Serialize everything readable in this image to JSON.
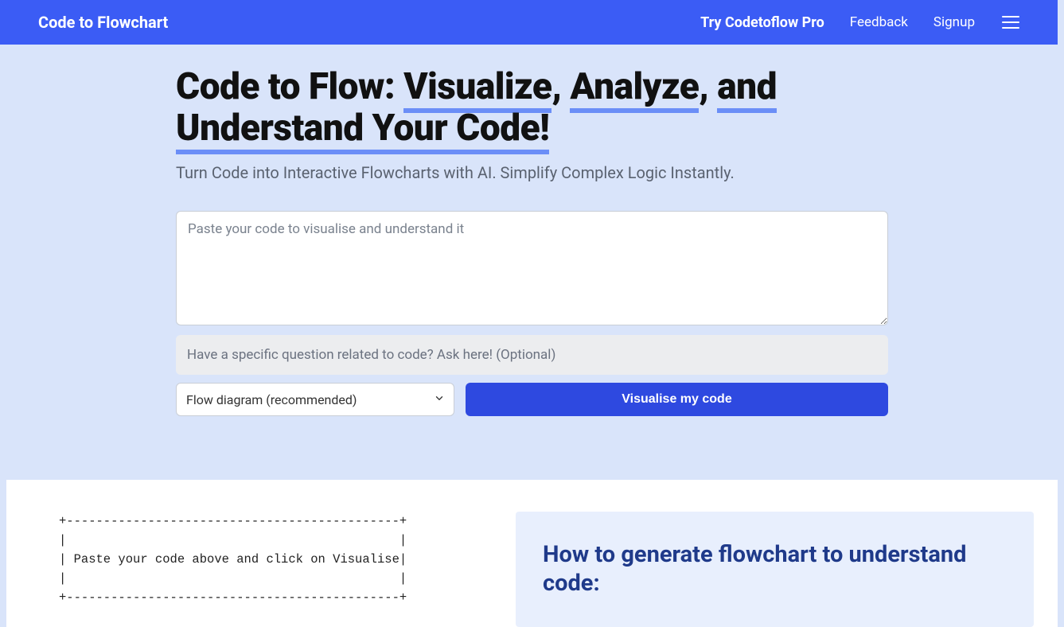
{
  "nav": {
    "brand": "Code to Flowchart",
    "pro_link": "Try Codetoflow Pro",
    "feedback_link": "Feedback",
    "signup_link": "Signup"
  },
  "hero": {
    "title_prefix": "Code to Flow: ",
    "underline1": "Visualize",
    "comma1": ", ",
    "underline2": "Analyze",
    "comma2": ", ",
    "underline3": "and",
    "space": " ",
    "underline4": "Understand Your Code!",
    "subtitle": "Turn Code into Interactive Flowcharts with AI. Simplify Complex Logic Instantly."
  },
  "form": {
    "code_placeholder": "Paste your code to visualise and understand it",
    "question_placeholder": "Have a specific question related to code? Ask here! (Optional)",
    "select_value": "Flow diagram (recommended)",
    "button_label": "Visualise my code"
  },
  "ascii": "+---------------------------------------------+\n|                                             |\n| Paste your code above and click on Visualise|\n|                                             |\n+---------------------------------------------+",
  "howto": {
    "title": "How to generate flowchart to understand code:"
  }
}
